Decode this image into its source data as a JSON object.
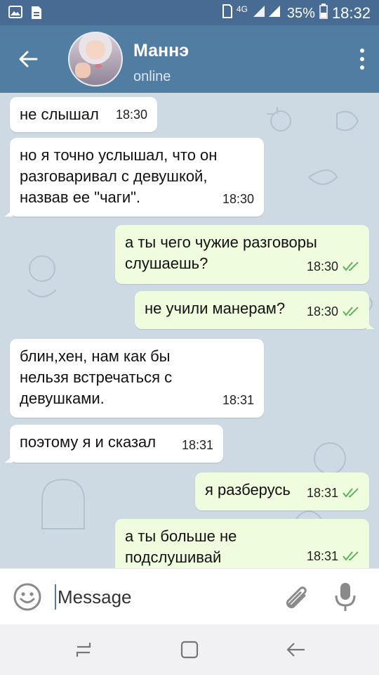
{
  "status_bar": {
    "network": "4G",
    "battery": "35%",
    "time": "18:32"
  },
  "header": {
    "contact_name": "Маннэ",
    "status": "online"
  },
  "messages": [
    {
      "dir": "in",
      "text": "не слышал",
      "time": "18:30"
    },
    {
      "dir": "in",
      "text": "но я точно услышал, что он\nразговаривал с девушкой,\nназвав ее \"чаги\".",
      "time": "18:30"
    },
    {
      "dir": "out",
      "text": "а ты чего чужие разговоры\nслушаешь?",
      "time": "18:30"
    },
    {
      "dir": "out",
      "text": "не учили манерам?",
      "time": "18:30"
    },
    {
      "dir": "in",
      "text": "блин,хен, нам как бы\nнельзя встречаться с\nдевушками.",
      "time": "18:31"
    },
    {
      "dir": "in",
      "text": "поэтому я и сказал",
      "time": "18:31"
    },
    {
      "dir": "out",
      "text": "я разберусь",
      "time": "18:31"
    },
    {
      "dir": "out",
      "text": "а ты больше не\nподслушивай",
      "time": "18:31"
    }
  ],
  "composer": {
    "placeholder": "Message"
  },
  "colors": {
    "header": "#517da2",
    "status_bar": "#476b92",
    "chat_bg": "#cdd9e3",
    "incoming": "#ffffff",
    "outgoing": "#effdde",
    "read_check": "#5bb55a"
  },
  "icons": [
    "back-arrow-icon",
    "menu-dots-icon",
    "emoji-icon",
    "attach-icon",
    "mic-icon",
    "double-check-icon"
  ]
}
